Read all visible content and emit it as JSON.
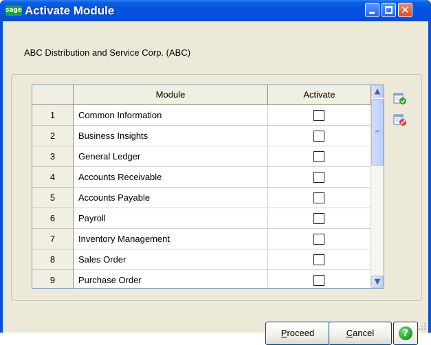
{
  "window": {
    "icon_text": "sage",
    "title": "Activate Module"
  },
  "company": "ABC Distribution and Service Corp. (ABC)",
  "grid": {
    "columns": [
      "Module",
      "Activate"
    ],
    "rows": [
      {
        "num": "1",
        "module": "Common Information",
        "activate": false
      },
      {
        "num": "2",
        "module": "Business Insights",
        "activate": false
      },
      {
        "num": "3",
        "module": "General Ledger",
        "activate": false
      },
      {
        "num": "4",
        "module": "Accounts Receivable",
        "activate": false
      },
      {
        "num": "5",
        "module": "Accounts Payable",
        "activate": false
      },
      {
        "num": "6",
        "module": "Payroll",
        "activate": false
      },
      {
        "num": "7",
        "module": "Inventory Management",
        "activate": false
      },
      {
        "num": "8",
        "module": "Sales Order",
        "activate": false
      },
      {
        "num": "9",
        "module": "Purchase Order",
        "activate": false
      }
    ]
  },
  "side_icons": [
    "select-all-icon",
    "clear-all-icon"
  ],
  "buttons": {
    "proceed_first": "P",
    "proceed_rest": "roceed",
    "cancel_first": "C",
    "cancel_rest": "ancel",
    "help_glyph": "?"
  },
  "colors": {
    "title_bar": "#0454DD",
    "dialog_bg": "#ECE9D8",
    "sage_green": "#13A53A",
    "help_green": "#1C9D2A"
  }
}
